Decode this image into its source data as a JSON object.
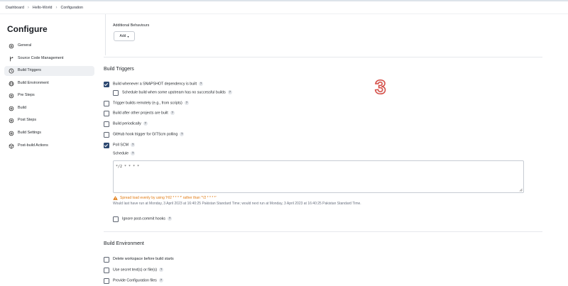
{
  "breadcrumb": [
    "Dashboard",
    "Hello-World",
    "Configuration"
  ],
  "sidebar": {
    "title": "Configure",
    "items": [
      {
        "label": "General",
        "icon": "gear-icon"
      },
      {
        "label": "Source Code Management",
        "icon": "branch-icon"
      },
      {
        "label": "Build Triggers",
        "icon": "clock-icon"
      },
      {
        "label": "Build Environment",
        "icon": "globe-icon"
      },
      {
        "label": "Pre Steps",
        "icon": "gear-icon"
      },
      {
        "label": "Build",
        "icon": "gear-icon"
      },
      {
        "label": "Post Steps",
        "icon": "gear-icon"
      },
      {
        "label": "Build Settings",
        "icon": "gear-icon"
      },
      {
        "label": "Post-build Actions",
        "icon": "cube-icon"
      }
    ],
    "active_index": 2
  },
  "additional_behaviours": {
    "label": "Additional Behaviours",
    "add_button": "Add"
  },
  "build_triggers": {
    "title": "Build Triggers",
    "options": [
      {
        "label": "Build whenever a SNAPSHOT dependency is built",
        "checked": true
      },
      {
        "label": "Schedule build when some upstream has no successful builds",
        "checked": false
      },
      {
        "label": "Trigger builds remotely (e.g., from scripts)",
        "checked": false
      },
      {
        "label": "Build after other projects are built",
        "checked": false
      },
      {
        "label": "Build periodically",
        "checked": false
      },
      {
        "label": "GitHub hook trigger for GITScm polling",
        "checked": false
      },
      {
        "label": "Poll SCM",
        "checked": true
      }
    ],
    "schedule_label": "Schedule",
    "schedule_value": "*/2 * * * *",
    "warning": "Spread load evenly by using 'H/2 * * * *' rather than '*/2 * * * *'",
    "note": "Would last have run at Monday, 3 April 2023 at 16:40:25 Pakistan Standard Time; would next run at Monday, 3 April 2023 at 16:40:25 Pakistan Standard Time.",
    "ignore_label": "Ignore post-commit hooks"
  },
  "annotation_number": "3",
  "build_environment": {
    "title": "Build Environment",
    "options": [
      {
        "label": "Delete workspace before build starts",
        "checked": false
      },
      {
        "label": "Use secret text(s) or file(s)",
        "checked": false
      },
      {
        "label": "Provide Configuration files",
        "checked": false
      }
    ]
  },
  "colors": {
    "checkbox_checked": "#2c4870",
    "warning": "#e07a12",
    "active_bg": "#eef0f3"
  }
}
